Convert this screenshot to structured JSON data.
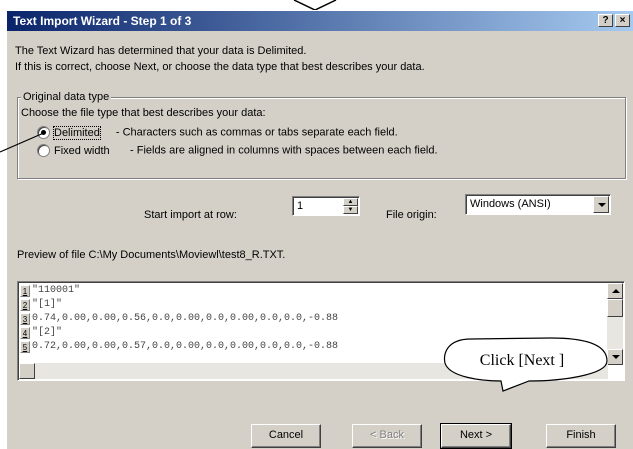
{
  "dialog": {
    "title": "Text Import Wizard - Step 1 of 3",
    "help_label": "?",
    "close_label": "×",
    "line1": "The Text Wizard has determined that your data is Delimited.",
    "line2": "If this is correct, choose Next, or choose the data type that best describes your data."
  },
  "original_data_type": {
    "group_title": "Original data type",
    "prompt": "Choose the file type that best describes your data:",
    "options": [
      {
        "label": "Delimited",
        "description": "- Characters such as commas or tabs separate each field.",
        "checked": true
      },
      {
        "label": "Fixed width",
        "description": "- Fields are aligned in columns with spaces between each field.",
        "checked": false
      }
    ]
  },
  "import": {
    "start_row_label": "Start import at row:",
    "start_row_value": "1",
    "file_origin_label": "File origin:",
    "file_origin_value": "Windows (ANSI)"
  },
  "preview": {
    "label": "Preview of file C:\\My Documents\\Moviewl\\test8_R.TXT.",
    "rows": [
      {
        "num": "1",
        "text": "\"110001\""
      },
      {
        "num": "2",
        "text": "\"[1]\""
      },
      {
        "num": "3",
        "text": "0.74,0.00,0.00,0.56,0.0,0.00,0.0,0.00,0.0,0.0,-0.88"
      },
      {
        "num": "4",
        "text": "\"[2]\""
      },
      {
        "num": "5",
        "text": "0.72,0.00,0.00,0.57,0.0,0.00,0.0,0.00,0.0,0.0,-0.88"
      }
    ]
  },
  "buttons": {
    "cancel": "Cancel",
    "back": "< Back",
    "next": "Next >",
    "finish": "Finish"
  },
  "annotation": {
    "callout": "Click [Next ]"
  },
  "colors": {
    "title_start": "#0a246a",
    "title_end": "#a6caf0",
    "face": "#d4d0c8"
  }
}
